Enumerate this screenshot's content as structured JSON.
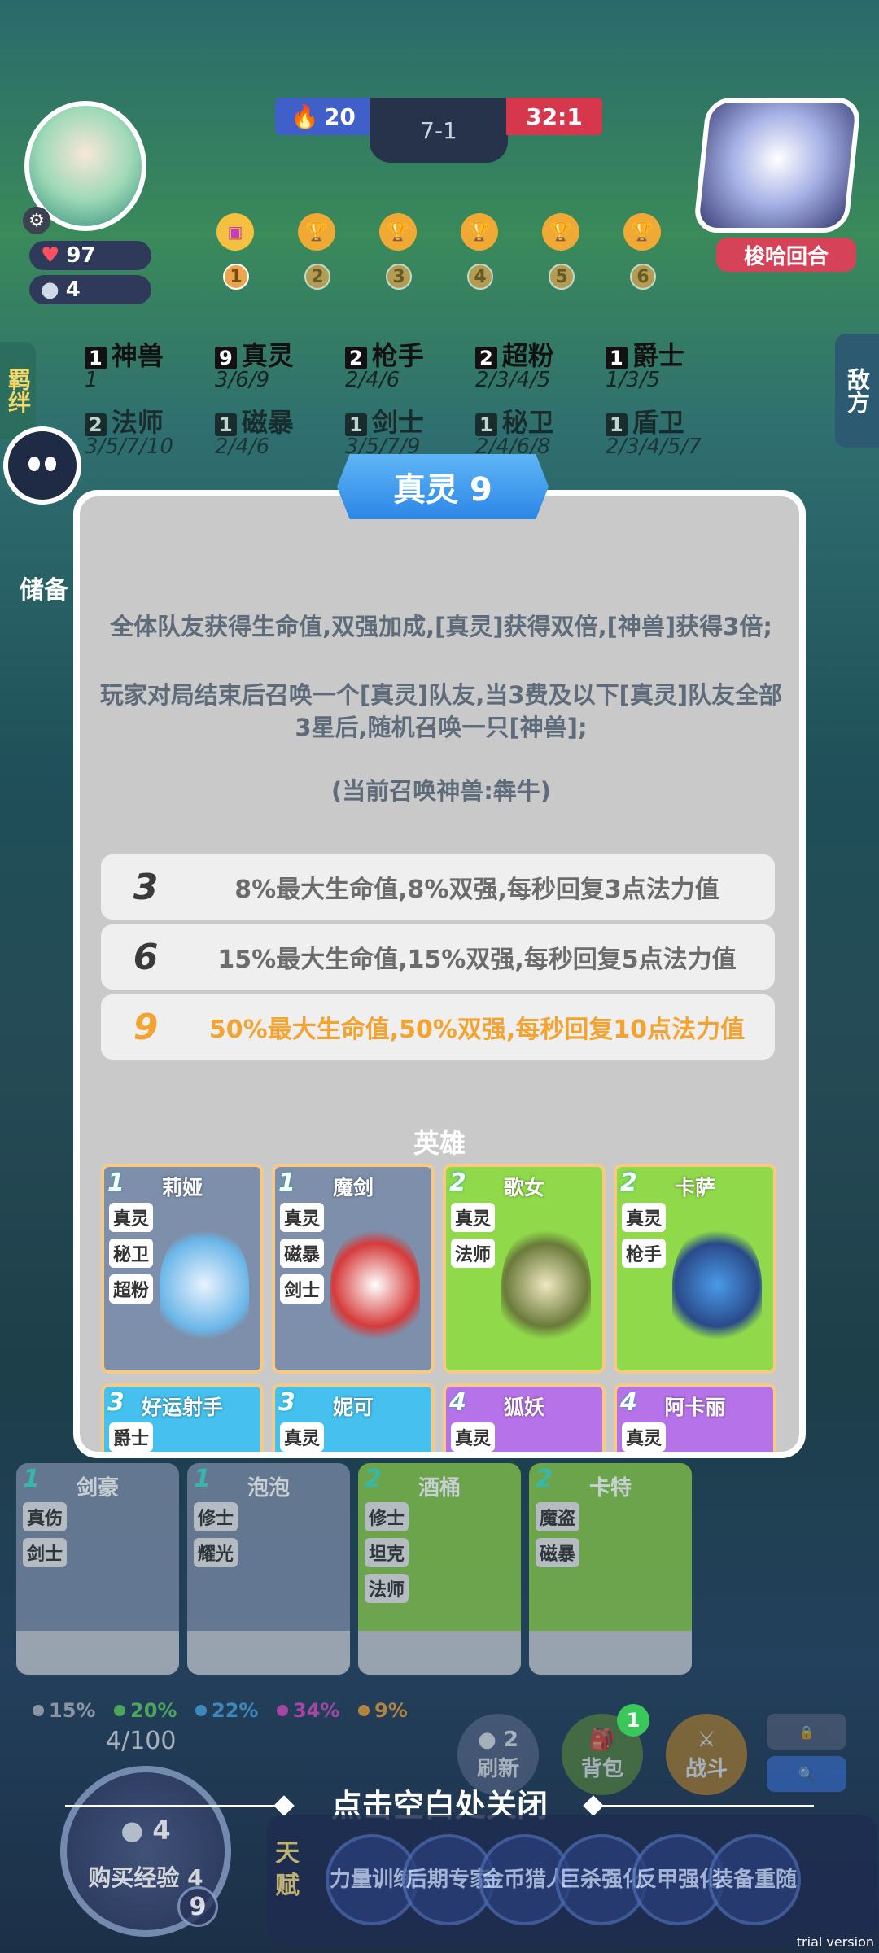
{
  "top": {
    "left_score": "20",
    "round": "7-1",
    "right_score": "32:1",
    "player_hp": "97",
    "player_coins": "4",
    "enemy_name": "梭哈回合",
    "round_nodes": [
      "1",
      "2",
      "3",
      "4",
      "5",
      "6"
    ]
  },
  "side": {
    "left_tab": "羁绊",
    "right_tab": "敌方",
    "storage": "储备"
  },
  "synergies_bg": [
    {
      "count": "1",
      "name": "神兽",
      "tiers": "1"
    },
    {
      "count": "9",
      "name": "真灵",
      "tiers": "3/6/9"
    },
    {
      "count": "2",
      "name": "枪手",
      "tiers": "2/4/6"
    },
    {
      "count": "2",
      "name": "超粉",
      "tiers": "2/3/4/5"
    },
    {
      "count": "1",
      "name": "爵士",
      "tiers": "1/3/5"
    },
    {
      "count": "2",
      "name": "法师",
      "tiers": "3/5/7/10"
    },
    {
      "count": "1",
      "name": "磁暴",
      "tiers": "2/4/6"
    },
    {
      "count": "1",
      "name": "剑士",
      "tiers": "3/5/7/9"
    },
    {
      "count": "1",
      "name": "秘卫",
      "tiers": "2/4/6/8"
    },
    {
      "count": "1",
      "name": "盾卫",
      "tiers": "2/3/4/5/7"
    }
  ],
  "dialog": {
    "title": "真灵 9",
    "desc_1": "全体队友获得生命值,双强加成,[真灵]获得双倍,[神兽]获得3倍;",
    "desc_2": "玩家对局结束后召唤一个[真灵]队友,当3费及以下[真灵]队友全部3星后,随机召唤一只[神兽];",
    "desc_3": "(当前召唤神兽:犇牛)",
    "tiers": [
      {
        "level": "3",
        "text": "8%最大生命值,8%双强,每秒回复3点法力值",
        "active": false
      },
      {
        "level": "6",
        "text": "15%最大生命值,15%双强,每秒回复5点法力值",
        "active": false
      },
      {
        "level": "9",
        "text": "50%最大生命值,50%双强,每秒回复10点法力值",
        "active": true
      }
    ],
    "heroes_header": "英雄",
    "heroes": [
      {
        "cost": "1",
        "name": "莉娅",
        "tags": [
          "真灵",
          "秘卫",
          "超粉"
        ],
        "bg": "#7d8faa"
      },
      {
        "cost": "1",
        "name": "魔剑",
        "tags": [
          "真灵",
          "磁暴",
          "剑士"
        ],
        "bg": "#7d8faa"
      },
      {
        "cost": "2",
        "name": "歌女",
        "tags": [
          "真灵",
          "法师"
        ],
        "bg": "#8fd94a"
      },
      {
        "cost": "2",
        "name": "卡萨",
        "tags": [
          "真灵",
          "枪手"
        ],
        "bg": "#8fd94a"
      },
      {
        "cost": "3",
        "name": "好运射手",
        "tags": [
          "爵士"
        ],
        "bg": "#46c0ee"
      },
      {
        "cost": "3",
        "name": "妮可",
        "tags": [
          "真灵"
        ],
        "bg": "#46c0ee"
      },
      {
        "cost": "4",
        "name": "狐妖",
        "tags": [
          "真灵"
        ],
        "bg": "#b672e8"
      },
      {
        "cost": "4",
        "name": "阿卡丽",
        "tags": [
          "真灵"
        ],
        "bg": "#b672e8"
      }
    ]
  },
  "shop": [
    {
      "cost": "1",
      "name": "剑豪",
      "tags": [
        "真伤",
        "剑士"
      ],
      "bg": "#7a8aa6"
    },
    {
      "cost": "1",
      "name": "泡泡",
      "tags": [
        "修士",
        "耀光"
      ],
      "bg": "#7a8aa6"
    },
    {
      "cost": "2",
      "name": "酒桶",
      "tags": [
        "修士",
        "坦克",
        "法师"
      ],
      "bg": "#86c64a"
    },
    {
      "cost": "2",
      "name": "卡特",
      "tags": [
        "魔盗",
        "磁暴"
      ],
      "bg": "#86c64a"
    }
  ],
  "odds": [
    {
      "value": "15%",
      "color": "#b6bcc6"
    },
    {
      "value": "20%",
      "color": "#5fd15f"
    },
    {
      "value": "22%",
      "color": "#4aa7e8"
    },
    {
      "value": "34%",
      "color": "#e04ac0"
    },
    {
      "value": "9%",
      "color": "#f0a23a"
    }
  ],
  "bottom": {
    "xp": "4/100",
    "buy_xp_cost": "4",
    "buy_xp": "购买经验 4",
    "level": "9",
    "refresh_cost": "2",
    "refresh": "刷新",
    "bag": "背包",
    "bag_badge": "1",
    "battle": "战斗",
    "close_tip": "点击空白处关闭",
    "talent_label": "天赋",
    "talents": [
      "力量训练",
      "后期专家",
      "金币猎人",
      "巨杀强化",
      "反甲强化",
      "装备重随"
    ],
    "trial": "trial version"
  },
  "colors": {
    "accent": "#f4a331",
    "dialog_bg": "#c9c9c9",
    "title_blue": "#2c86e6"
  }
}
